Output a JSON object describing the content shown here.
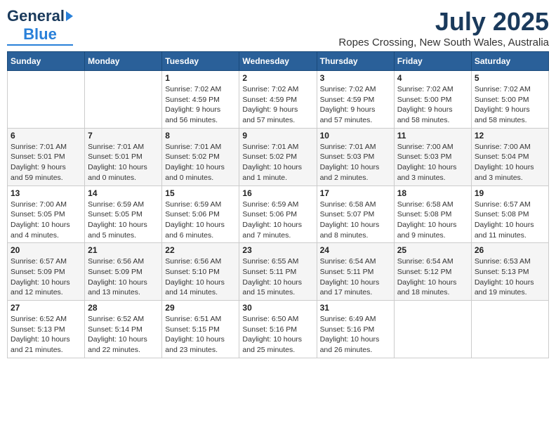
{
  "header": {
    "logo_general": "General",
    "logo_blue": "Blue",
    "month": "July 2025",
    "location": "Ropes Crossing, New South Wales, Australia"
  },
  "weekdays": [
    "Sunday",
    "Monday",
    "Tuesday",
    "Wednesday",
    "Thursday",
    "Friday",
    "Saturday"
  ],
  "weeks": [
    [
      {
        "day": "",
        "info": ""
      },
      {
        "day": "",
        "info": ""
      },
      {
        "day": "1",
        "info": "Sunrise: 7:02 AM\nSunset: 4:59 PM\nDaylight: 9 hours\nand 56 minutes."
      },
      {
        "day": "2",
        "info": "Sunrise: 7:02 AM\nSunset: 4:59 PM\nDaylight: 9 hours\nand 57 minutes."
      },
      {
        "day": "3",
        "info": "Sunrise: 7:02 AM\nSunset: 4:59 PM\nDaylight: 9 hours\nand 57 minutes."
      },
      {
        "day": "4",
        "info": "Sunrise: 7:02 AM\nSunset: 5:00 PM\nDaylight: 9 hours\nand 58 minutes."
      },
      {
        "day": "5",
        "info": "Sunrise: 7:02 AM\nSunset: 5:00 PM\nDaylight: 9 hours\nand 58 minutes."
      }
    ],
    [
      {
        "day": "6",
        "info": "Sunrise: 7:01 AM\nSunset: 5:01 PM\nDaylight: 9 hours\nand 59 minutes."
      },
      {
        "day": "7",
        "info": "Sunrise: 7:01 AM\nSunset: 5:01 PM\nDaylight: 10 hours\nand 0 minutes."
      },
      {
        "day": "8",
        "info": "Sunrise: 7:01 AM\nSunset: 5:02 PM\nDaylight: 10 hours\nand 0 minutes."
      },
      {
        "day": "9",
        "info": "Sunrise: 7:01 AM\nSunset: 5:02 PM\nDaylight: 10 hours\nand 1 minute."
      },
      {
        "day": "10",
        "info": "Sunrise: 7:01 AM\nSunset: 5:03 PM\nDaylight: 10 hours\nand 2 minutes."
      },
      {
        "day": "11",
        "info": "Sunrise: 7:00 AM\nSunset: 5:03 PM\nDaylight: 10 hours\nand 3 minutes."
      },
      {
        "day": "12",
        "info": "Sunrise: 7:00 AM\nSunset: 5:04 PM\nDaylight: 10 hours\nand 3 minutes."
      }
    ],
    [
      {
        "day": "13",
        "info": "Sunrise: 7:00 AM\nSunset: 5:05 PM\nDaylight: 10 hours\nand 4 minutes."
      },
      {
        "day": "14",
        "info": "Sunrise: 6:59 AM\nSunset: 5:05 PM\nDaylight: 10 hours\nand 5 minutes."
      },
      {
        "day": "15",
        "info": "Sunrise: 6:59 AM\nSunset: 5:06 PM\nDaylight: 10 hours\nand 6 minutes."
      },
      {
        "day": "16",
        "info": "Sunrise: 6:59 AM\nSunset: 5:06 PM\nDaylight: 10 hours\nand 7 minutes."
      },
      {
        "day": "17",
        "info": "Sunrise: 6:58 AM\nSunset: 5:07 PM\nDaylight: 10 hours\nand 8 minutes."
      },
      {
        "day": "18",
        "info": "Sunrise: 6:58 AM\nSunset: 5:08 PM\nDaylight: 10 hours\nand 9 minutes."
      },
      {
        "day": "19",
        "info": "Sunrise: 6:57 AM\nSunset: 5:08 PM\nDaylight: 10 hours\nand 11 minutes."
      }
    ],
    [
      {
        "day": "20",
        "info": "Sunrise: 6:57 AM\nSunset: 5:09 PM\nDaylight: 10 hours\nand 12 minutes."
      },
      {
        "day": "21",
        "info": "Sunrise: 6:56 AM\nSunset: 5:09 PM\nDaylight: 10 hours\nand 13 minutes."
      },
      {
        "day": "22",
        "info": "Sunrise: 6:56 AM\nSunset: 5:10 PM\nDaylight: 10 hours\nand 14 minutes."
      },
      {
        "day": "23",
        "info": "Sunrise: 6:55 AM\nSunset: 5:11 PM\nDaylight: 10 hours\nand 15 minutes."
      },
      {
        "day": "24",
        "info": "Sunrise: 6:54 AM\nSunset: 5:11 PM\nDaylight: 10 hours\nand 17 minutes."
      },
      {
        "day": "25",
        "info": "Sunrise: 6:54 AM\nSunset: 5:12 PM\nDaylight: 10 hours\nand 18 minutes."
      },
      {
        "day": "26",
        "info": "Sunrise: 6:53 AM\nSunset: 5:13 PM\nDaylight: 10 hours\nand 19 minutes."
      }
    ],
    [
      {
        "day": "27",
        "info": "Sunrise: 6:52 AM\nSunset: 5:13 PM\nDaylight: 10 hours\nand 21 minutes."
      },
      {
        "day": "28",
        "info": "Sunrise: 6:52 AM\nSunset: 5:14 PM\nDaylight: 10 hours\nand 22 minutes."
      },
      {
        "day": "29",
        "info": "Sunrise: 6:51 AM\nSunset: 5:15 PM\nDaylight: 10 hours\nand 23 minutes."
      },
      {
        "day": "30",
        "info": "Sunrise: 6:50 AM\nSunset: 5:16 PM\nDaylight: 10 hours\nand 25 minutes."
      },
      {
        "day": "31",
        "info": "Sunrise: 6:49 AM\nSunset: 5:16 PM\nDaylight: 10 hours\nand 26 minutes."
      },
      {
        "day": "",
        "info": ""
      },
      {
        "day": "",
        "info": ""
      }
    ]
  ]
}
